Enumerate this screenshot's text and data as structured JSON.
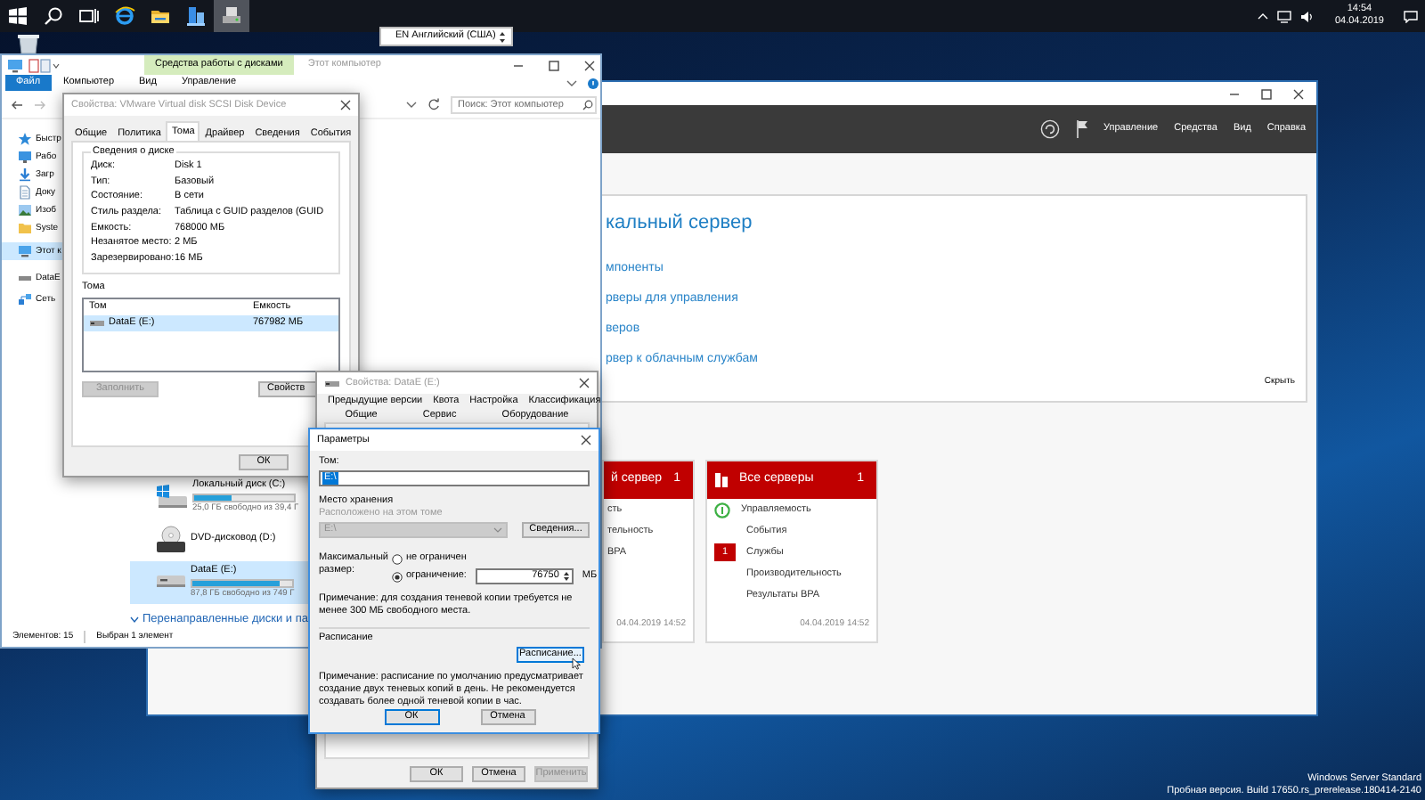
{
  "taskbar": {
    "apps": [
      {
        "kind": "start",
        "selected": false
      },
      {
        "kind": "search",
        "selected": false
      },
      {
        "kind": "task_view",
        "selected": false
      },
      {
        "kind": "browser",
        "selected": false
      },
      {
        "kind": "explorer",
        "selected": false
      },
      {
        "kind": "server_manager",
        "selected": false
      },
      {
        "kind": "disk_tool",
        "selected": true
      }
    ],
    "time": "14:54",
    "date": "04.04.2019"
  },
  "language_bar": {
    "value": "EN Английский (США)"
  },
  "server_manager": {
    "menu": [
      "Управление",
      "Средства",
      "Вид",
      "Справка"
    ],
    "welcome": {
      "heading": "кальный сервер",
      "links": [
        "мпоненты",
        "рверы для управления",
        "веров",
        "рвер к облачным службам"
      ],
      "hide": "Скрыть"
    },
    "tiles": [
      {
        "title": "й сервер",
        "count": "1",
        "rows": [
          {
            "label": "сть"
          },
          {
            "label": "тельность"
          },
          {
            "label": "BPA"
          }
        ],
        "timestamp": "04.04.2019 14:52"
      },
      {
        "title": "Все серверы",
        "count": "1",
        "rows": [
          {
            "label": "Управляемость",
            "kind": "status"
          },
          {
            "label": "События",
            "kind": "plain"
          },
          {
            "label": "Службы",
            "kind": "alert",
            "badge": "1"
          },
          {
            "label": "Производительность",
            "kind": "plain"
          },
          {
            "label": "Результаты BPA",
            "kind": "plain"
          }
        ],
        "timestamp": "04.04.2019 14:52"
      }
    ]
  },
  "explorer": {
    "tool_tab": "Средства работы с дисками",
    "title": "Этот компьютер",
    "ribbon_tabs": [
      {
        "label": "Файл",
        "kind": "file"
      },
      {
        "label": "Компьютер",
        "kind": "tab"
      },
      {
        "label": "Вид",
        "kind": "tab"
      },
      {
        "label": "Управление",
        "kind": "tab"
      }
    ],
    "search": {
      "placeholder": "Поиск: Этот компьютер"
    },
    "nav": [
      {
        "label": "Быстр",
        "kind": "quick",
        "selected": false
      },
      {
        "label": "Рабо",
        "kind": "desktop",
        "selected": false
      },
      {
        "label": "Загр",
        "kind": "downloads",
        "selected": false
      },
      {
        "label": "Доку",
        "kind": "documents",
        "selected": false
      },
      {
        "label": "Изоб",
        "kind": "pictures",
        "selected": false
      },
      {
        "label": "Syste",
        "kind": "folder",
        "selected": false
      },
      {
        "label": "Этот к",
        "kind": "pc",
        "selected": true
      },
      {
        "label": "DataE",
        "kind": "drive",
        "selected": false
      },
      {
        "label": "Сеть",
        "kind": "network",
        "selected": false
      }
    ],
    "drives": [
      {
        "kind": "local",
        "name": "Локальный диск (C:)",
        "level": 0.37,
        "free": "25,0 ГБ свободно из 39,4 Г",
        "selected": false
      },
      {
        "kind": "dvd",
        "name": "DVD-дисковод (D:)",
        "selected": false
      },
      {
        "kind": "data",
        "name": "DataE (E:)",
        "level": 0.88,
        "free": "87,8 ГБ свободно из 749 Г",
        "selected": true
      }
    ],
    "group_header": "Перенаправленные диски и па",
    "status": [
      "Элементов: 15",
      "Выбран 1 элемент"
    ]
  },
  "disk_properties": {
    "title": "Свойства: VMware Virtual disk SCSI Disk Device",
    "tabs": [
      {
        "label": "Общие",
        "selected": false
      },
      {
        "label": "Политика",
        "selected": false
      },
      {
        "label": "Тома",
        "selected": true
      },
      {
        "label": "Драйвер",
        "selected": false
      },
      {
        "label": "Сведения",
        "selected": false
      },
      {
        "label": "События",
        "selected": false
      }
    ],
    "disk_info": {
      "title": "Сведения о диске",
      "fields": [
        {
          "label": "Диск:",
          "value": "Disk 1"
        },
        {
          "label": "Тип:",
          "value": "Базовый"
        },
        {
          "label": "Состояние:",
          "value": "В сети"
        },
        {
          "label": "Стиль раздела:",
          "value": "Таблица с GUID разделов (GUID"
        },
        {
          "label": "Емкость:",
          "value": "768000 МБ"
        },
        {
          "label": "Незанятое место:",
          "value": "2 МБ"
        },
        {
          "label": "Зарезервировано:",
          "value": "16 МБ"
        }
      ]
    },
    "volumes": {
      "title": "Тома",
      "columns": [
        "Том",
        "Емкость"
      ],
      "rows": [
        {
          "cells": [
            "DataE (E:)",
            "767982 МБ"
          ],
          "selected": true
        }
      ]
    },
    "buttons": [
      {
        "label": "Заполнить",
        "disabled": true
      },
      {
        "label": "Свойств",
        "disabled": false
      }
    ],
    "footer_buttons": [
      "ОК"
    ]
  },
  "volume_properties": {
    "title": "Свойства: DataE (E:)",
    "tab_rows": [
      {
        "tabs": [
          {
            "label": "Предыдущие версии",
            "selected": false
          },
          {
            "label": "Квота",
            "selected": false
          },
          {
            "label": "Настройка",
            "selected": false
          },
          {
            "label": "Классификация",
            "selected": false
          }
        ]
      },
      {
        "tabs": [
          {
            "label": "Общие",
            "selected": false
          },
          {
            "label": "Сервис",
            "selected": false
          },
          {
            "label": "Оборудование",
            "selected": false
          }
        ]
      }
    ],
    "buttons": [
      {
        "label": "ОК",
        "disabled": false
      },
      {
        "label": "Отмена",
        "disabled": false
      },
      {
        "label": "Применить",
        "disabled": true
      }
    ]
  },
  "settings_dialog": {
    "title": "Параметры",
    "volume": {
      "label": "Том:",
      "value": "E:\\"
    },
    "storage": {
      "label": "Место хранения",
      "location_label": "Расположено на этом томе",
      "location": "E:\\",
      "disabled": true,
      "details_button": "Сведения..."
    },
    "max_size": {
      "label": "Максимальный размер:",
      "options": [
        {
          "label": "не ограничен",
          "selected": false
        },
        {
          "label": "ограничение:",
          "selected": true
        }
      ],
      "limit": "76750",
      "unit": "МБ"
    },
    "note": "Примечание: для создания теневой копии требуется не менее 300 МБ свободного места.",
    "schedule": {
      "label": "Расписание",
      "button": "Расписание...",
      "note": "Примечание: расписание по умолчанию предусматривает создание двух теневых копий в день. Не рекомендуется создавать более одной теневой копии в час."
    },
    "buttons": [
      {
        "label": "ОК",
        "default": true
      },
      {
        "label": "Отмена",
        "default": false
      }
    ]
  },
  "desktop": {
    "edition": "Windows Server Standard",
    "build": "Пробная версия. Build 17650.rs_prerelease.180414-2140"
  }
}
